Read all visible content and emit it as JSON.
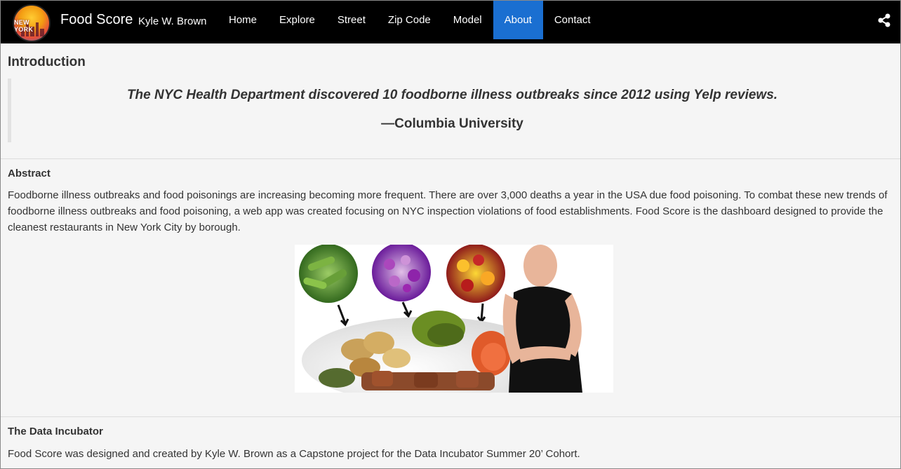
{
  "navbar": {
    "logo_text": "NEW YORK",
    "brand": "Food Score",
    "author": "Kyle W. Brown",
    "items": [
      {
        "label": "Home",
        "active": false
      },
      {
        "label": "Explore",
        "active": false
      },
      {
        "label": "Street",
        "active": false
      },
      {
        "label": "Zip Code",
        "active": false
      },
      {
        "label": "Model",
        "active": false
      },
      {
        "label": "About",
        "active": true
      },
      {
        "label": "Contact",
        "active": false
      }
    ],
    "share_icon": "share-icon",
    "active_color": "#1a6fd1"
  },
  "intro": {
    "heading": "Introduction",
    "quote": "The NYC Health Department discovered 10 foodborne illness outbreaks since 2012 using Yelp reviews.",
    "source": "—Columbia University"
  },
  "abstract": {
    "heading": "Abstract",
    "text": "Foodborne illness outbreaks and food poisonings are increasing becoming more frequent. There are over 3,000 deaths a year in the USA due food poisoning. To combat these new trends of foodborne illness outbreaks and food poisoning, a web app was created focusing on NYC inspection violations of food establishments. Food Score is the dashboard designed to provide the cleanest restaurants in New York City by borough."
  },
  "incubator": {
    "heading": "The Data Incubator",
    "text": "Food Score was designed and created by Kyle W. Brown as a Capstone project for the Data Incubator Summer 20’ Cohort."
  }
}
